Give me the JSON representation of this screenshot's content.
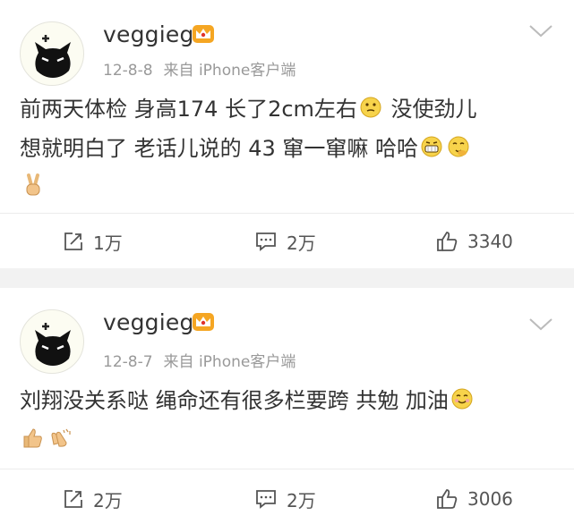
{
  "posts": [
    {
      "username": "veggieg",
      "date": "12-8-8",
      "source": "来自 iPhone客户端",
      "content": {
        "line1": "前两天体检 身高174 长了2cm左右",
        "line1_after": " 没使劲儿",
        "line2": "想就明白了 老话儿说的 43 窜一窜嘛 哈哈"
      },
      "emojis": [
        "thinking-face",
        "grin-face",
        "blushing-laugh-face",
        "victory-hand"
      ],
      "actions": {
        "repost": "1万",
        "comment": "2万",
        "like": "3340"
      }
    },
    {
      "username": "veggieg",
      "date": "12-8-7",
      "source": "来自 iPhone客户端",
      "content": {
        "line1": "刘翔没关系哒 绳命还有很多栏要跨 共勉 加油"
      },
      "emojis": [
        "smile-face",
        "thumbs-up",
        "clapping-hands"
      ],
      "actions": {
        "repost": "2万",
        "comment": "2万",
        "like": "3006"
      }
    }
  ],
  "colors": {
    "background": "#f2f2f2",
    "card": "#ffffff",
    "meta": "#999999",
    "text": "#333333",
    "crown": "#f5a623",
    "crown_jewel": "#e0322b"
  }
}
